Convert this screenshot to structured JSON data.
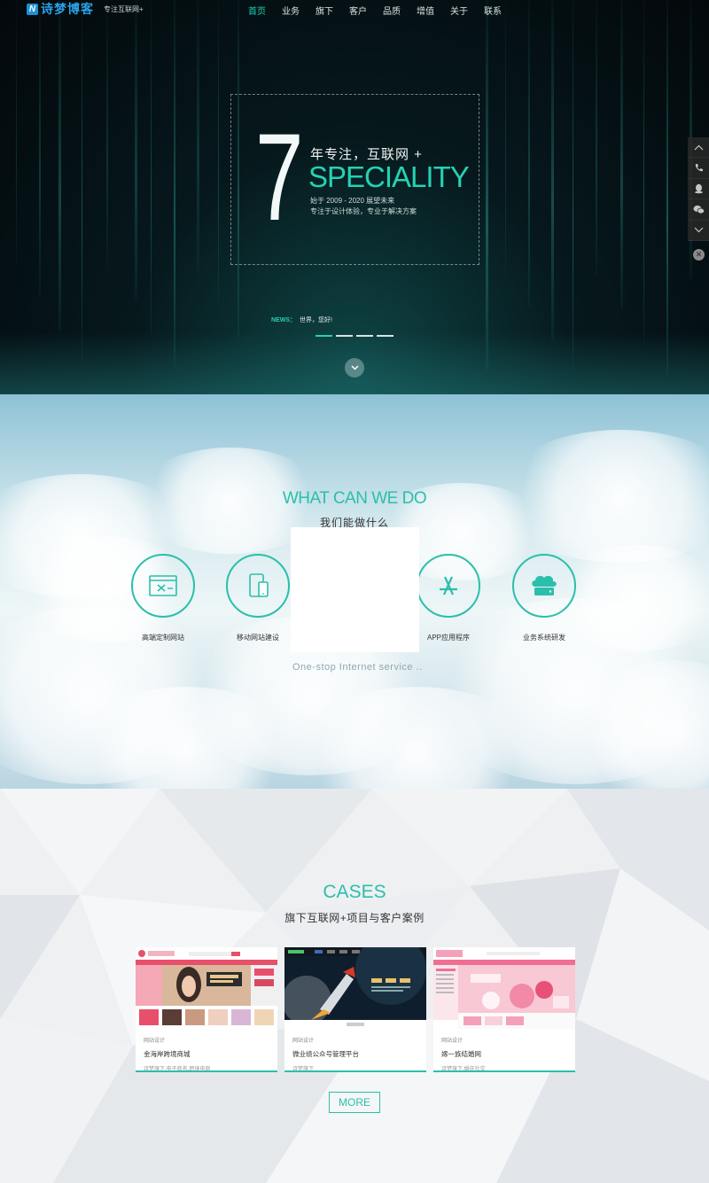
{
  "brand": {
    "logo_text": "诗梦博客",
    "logo_letter": "N",
    "slogan": "专注互联网+"
  },
  "nav": [
    {
      "label": "首页",
      "active": true
    },
    {
      "label": "业务"
    },
    {
      "label": "旗下"
    },
    {
      "label": "客户"
    },
    {
      "label": "品质"
    },
    {
      "label": "增值"
    },
    {
      "label": "关于"
    },
    {
      "label": "联系"
    }
  ],
  "hero": {
    "number": "7",
    "headline_cn": "年专注，互联网 +",
    "headline_en": "SPECIALITY",
    "sub1": "始于 2009 - 2020 展望未来",
    "sub2": "专注于设计体验，专业于解决方案",
    "news_label": "NEWS：",
    "news_text": "世界，您好!",
    "slide_count": 4,
    "active_slide": 1,
    "scroll_icon": "chevron-down-icon"
  },
  "side_tools": {
    "icons": [
      "chevron-up-icon",
      "phone-icon",
      "qq-icon",
      "wechat-icon",
      "chevron-down-icon"
    ],
    "close_icon": "close-icon",
    "close_glyph": "✕"
  },
  "services": {
    "title_en": "WHAT CAN WE DO",
    "title_cn": "我们能做什么",
    "items": [
      {
        "label": "高端定制网站",
        "icon": "website-icon"
      },
      {
        "label": "移动网站建设",
        "icon": "mobile-icon"
      },
      {
        "label": "",
        "icon": "hidden-icon"
      },
      {
        "label": "APP应用程序",
        "icon": "app-store-icon"
      },
      {
        "label": "业务系统研发",
        "icon": "cloud-server-icon"
      }
    ],
    "tagline": "One-stop Internet service .."
  },
  "cases": {
    "title_en": "CASES",
    "title_cn": "旗下互联网+项目与客户案例",
    "items": [
      {
        "category": "网站设计",
        "title": "金海岸跨境商城",
        "desc": "诗梦旗下,电子商务,跨境电商",
        "theme": "#e84f6a"
      },
      {
        "category": "网站设计",
        "title": "微业绩公众号管理平台",
        "desc": "诗梦旗下",
        "theme": "#1e2a36"
      },
      {
        "category": "网站设计",
        "title": "嫁一族结婚网",
        "desc": "诗梦旗下,婚庆社交",
        "theme": "#f3a0b8"
      }
    ],
    "more_label": "MORE"
  }
}
